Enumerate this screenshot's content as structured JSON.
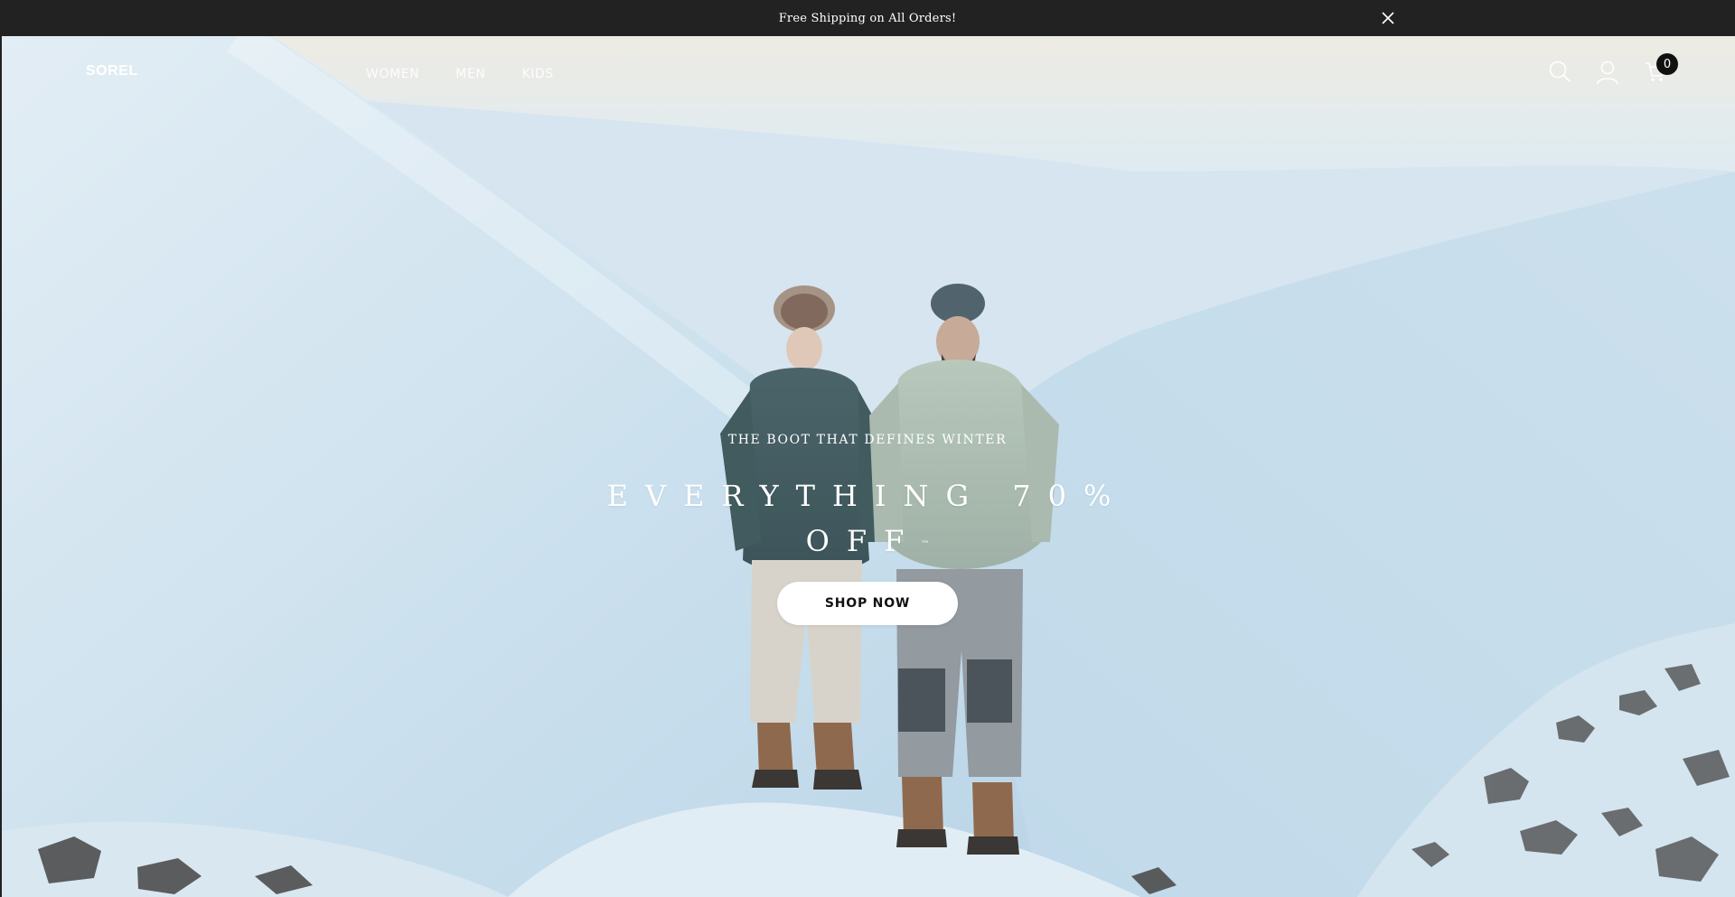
{
  "announcement": {
    "text": "Free Shipping on All Orders!",
    "close_icon": "close-icon"
  },
  "header": {
    "logo": "SOREL",
    "nav": [
      {
        "label": "WOMEN"
      },
      {
        "label": "MEN"
      },
      {
        "label": "KIDS"
      }
    ],
    "icons": [
      "search-icon",
      "user-icon",
      "cart-icon"
    ],
    "cart_count": "0"
  },
  "hero": {
    "eyebrow": "THE BOOT THAT DEFINES WINTER",
    "headline": "EVERYTHING 70% OFF",
    "trademark": "™",
    "cta_label": "SHOP NOW"
  },
  "colors": {
    "announcement_bg": "#222222",
    "button_bg": "#ffffff",
    "badge_bg": "#111111",
    "text_on_hero": "#ffffff"
  }
}
